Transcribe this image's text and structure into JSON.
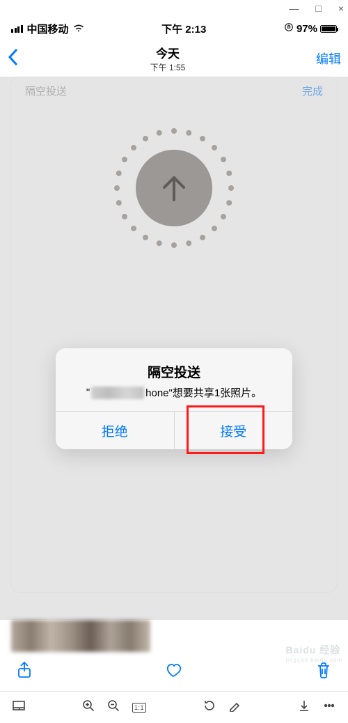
{
  "window": {
    "min": "—",
    "max": "□",
    "close": "×"
  },
  "status": {
    "carrier": "中国移动",
    "time": "下午 2:13",
    "battery": "97%"
  },
  "nav": {
    "title": "今天",
    "subtitle": "下午 1:55",
    "edit": "编辑"
  },
  "card_header": {
    "left": "隔空投送",
    "right": "完成"
  },
  "alert": {
    "title": "隔空投送",
    "msg_suffix": "hone\"想要共享1张照片。",
    "decline": "拒绝",
    "accept": "接受"
  },
  "watermark": {
    "brand": "Baidu 经验",
    "sub": "jingyan.baidu.com"
  }
}
